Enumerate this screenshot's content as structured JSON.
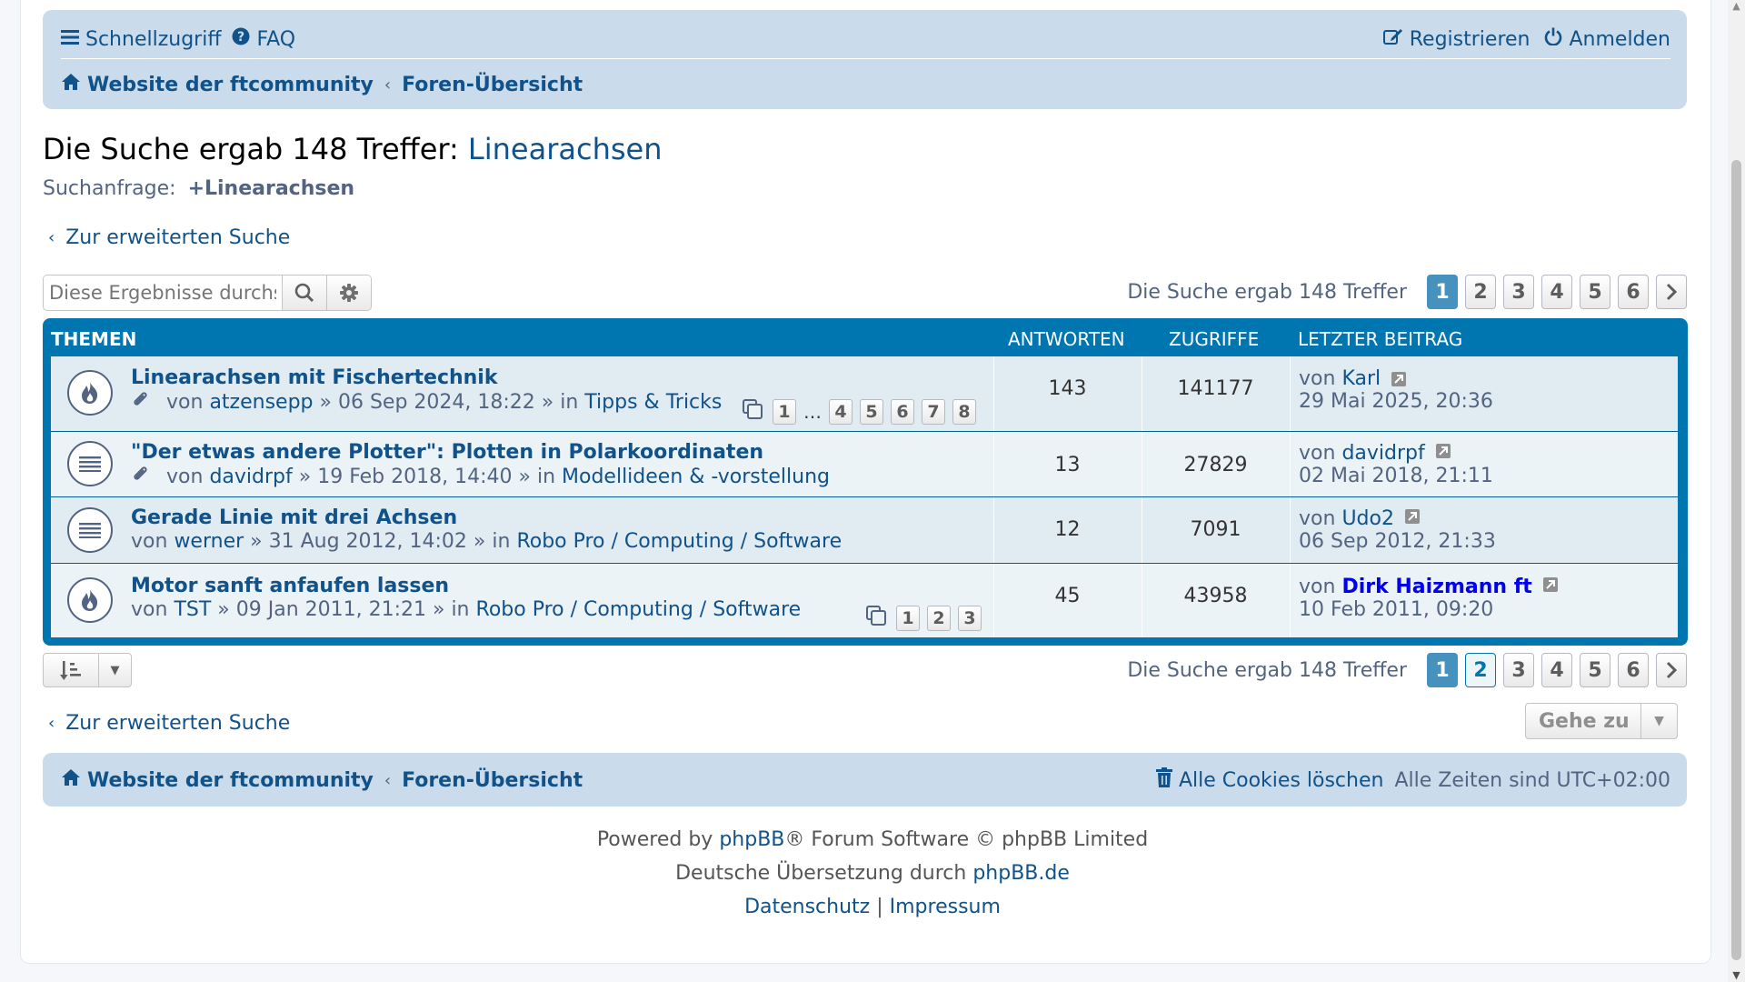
{
  "nav": {
    "quick_access": "Schnellzugriff",
    "faq": "FAQ",
    "register": "Registrieren",
    "login": "Anmelden"
  },
  "breadcrumb": {
    "home": "Website der ftcommunity",
    "forum_index": "Foren-Übersicht"
  },
  "search": {
    "title_prefix": "Die Suche ergab 148 Treffer:",
    "title_query": "Linearachsen",
    "query_label": "Suchanfrage:",
    "query_value": "+Linearachsen",
    "back_label": "Zur erweiterten Suche",
    "filter_placeholder": "Diese Ergebnisse durchsuchen"
  },
  "pagination": {
    "summary": "Die Suche ergab 148 Treffer",
    "pages": [
      "1",
      "2",
      "3",
      "4",
      "5",
      "6"
    ],
    "current": "1"
  },
  "table": {
    "headers": {
      "topics": "THEMEN",
      "replies": "ANTWORTEN",
      "views": "ZUGRIFFE",
      "last_post": "LETZTER BEITRAG"
    },
    "rows": [
      {
        "title": "Linearachsen mit Fischertechnik",
        "by": "von",
        "author": "atzensepp",
        "date": "» 06 Sep 2024, 18:22 » in",
        "forum": "Tipps & Tricks",
        "pages": [
          "1",
          "…",
          "4",
          "5",
          "6",
          "7",
          "8"
        ],
        "replies": "143",
        "views": "141177",
        "last_by": "von",
        "last_author": "Karl",
        "last_date": "29 Mai 2025, 20:36",
        "icon": "fire-icon"
      },
      {
        "title": "\"Der etwas andere Plotter\": Plotten in Polarkoordinaten",
        "by": "von",
        "author": "davidrpf",
        "date": "» 19 Feb 2018, 14:40 » in",
        "forum": "Modellideen & -vorstellung",
        "replies": "13",
        "views": "27829",
        "last_by": "von",
        "last_author": "davidrpf",
        "last_date": "02 Mai 2018, 21:11",
        "icon": "topic-read-icon"
      },
      {
        "title": "Gerade Linie mit drei Achsen",
        "by": "von",
        "author": "werner",
        "date": "» 31 Aug 2012, 14:02 » in",
        "forum": "Robo Pro / Computing / Software",
        "replies": "12",
        "views": "7091",
        "last_by": "von",
        "last_author": "Udo2",
        "last_date": "06 Sep 2012, 21:33",
        "icon": "topic-read-icon"
      },
      {
        "title": "Motor sanft anfaufen lassen",
        "by": "von",
        "author": "TST",
        "date": "» 09 Jan 2011, 21:21 » in",
        "forum": "Robo Pro / Computing / Software",
        "pages": [
          "1",
          "2",
          "3"
        ],
        "replies": "45",
        "views": "43958",
        "last_by": "von",
        "last_author": "Dirk Haizmann ft",
        "last_date": "10 Feb 2011, 09:20",
        "icon": "fire-icon"
      }
    ]
  },
  "jump": {
    "label": "Gehe zu"
  },
  "footer": {
    "delete_cookies": "Alle Cookies löschen",
    "timezone": "Alle Zeiten sind UTC+02:00",
    "powered_prefix": "Powered by",
    "phpbb": "phpBB",
    "powered_suffix": "® Forum Software © phpBB Limited",
    "translation_prefix": "Deutsche Übersetzung durch",
    "translation_link": "phpBB.de",
    "privacy": "Datenschutz",
    "separator": "|",
    "imprint": "Impressum"
  },
  "colors": {
    "accent": "#0076b1",
    "link": "#105289",
    "navbar": "#cadceb",
    "active_page": "#4692bf"
  }
}
